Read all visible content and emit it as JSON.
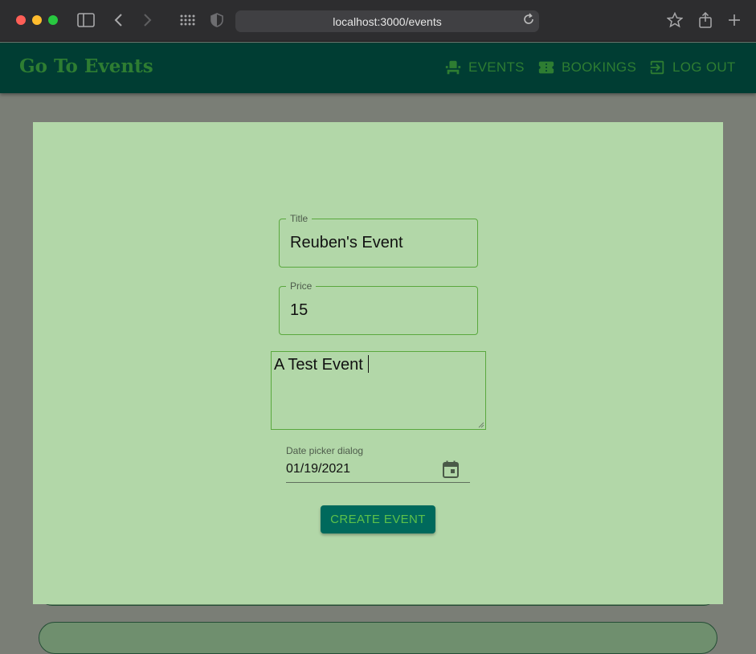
{
  "browser": {
    "url": "localhost:3000/events"
  },
  "appbar": {
    "brand": "Go To Events",
    "nav": {
      "events": "EVENTS",
      "bookings": "BOOKINGS",
      "logout": "LOG OUT"
    }
  },
  "form": {
    "title_label": "Title",
    "title_value": "Reuben's Event",
    "price_label": "Price",
    "price_value": "15",
    "description_value": "A Test Event",
    "date_label": "Date picker dialog",
    "date_value": "01/19/2021",
    "submit_label": "CREATE EVENT"
  },
  "colors": {
    "appbar": "#003d33",
    "brand_text": "#2e7d32",
    "modal_background": "#b2d7a8",
    "field_border": "#5aa83e",
    "button_background": "#00695c",
    "button_text": "#5cc14a"
  }
}
